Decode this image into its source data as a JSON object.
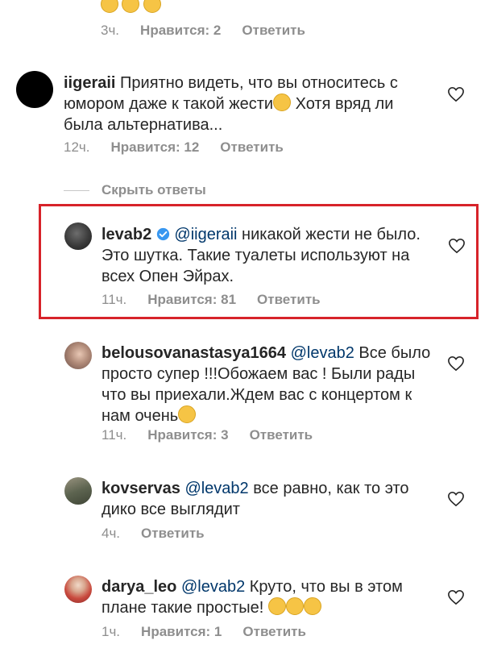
{
  "top_comment": {
    "time": "3ч.",
    "likes": "Нравится: 2",
    "reply": "Ответить"
  },
  "comments": [
    {
      "username": "iigeraii",
      "text_before": "Приятно видеть, что вы относитесь с юмором даже к такой жести",
      "text_after": " Хотя вряд ли была альтернатива...",
      "time": "12ч.",
      "likes": "Нравится: 12",
      "reply": "Ответить"
    }
  ],
  "hide_replies": "Скрыть ответы",
  "replies": [
    {
      "username": "levab2",
      "verified": true,
      "mention": "@iigeraii",
      "text": " никакой жести не было. Это шутка. Такие туалеты используют на всех Опен Эйрах.",
      "time": "11ч.",
      "likes": "Нравится: 81",
      "reply": "Ответить"
    },
    {
      "username": "belousovanastasya1664",
      "mention": "@levab2",
      "text": " Все было просто супер !!!Обожаем вас ! Были рады что вы приехали.Ждем вас с концертом к нам очень",
      "time": "11ч.",
      "likes": "Нравится: 3",
      "reply": "Ответить"
    },
    {
      "username": "kovservas",
      "mention": "@levab2",
      "text": " все равно, как то это дико все выглядит",
      "time": "4ч.",
      "reply": "Ответить"
    },
    {
      "username": "darya_leo",
      "mention": "@levab2",
      "text": " Круто, что вы в этом плане такие простые!",
      "time": "1ч.",
      "likes": "Нравится: 1",
      "reply": "Ответить"
    }
  ],
  "colors": {
    "highlight": "#d7232a",
    "mention": "#00376b",
    "meta": "#8e8e8e",
    "verified": "#3897f0"
  }
}
